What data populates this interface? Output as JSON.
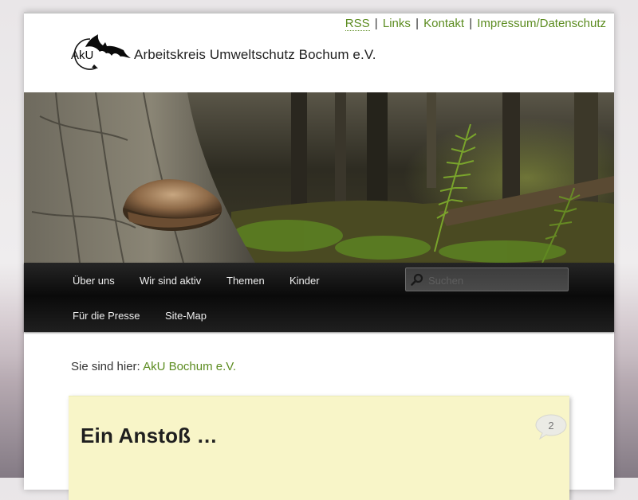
{
  "top_links": {
    "rss": "RSS",
    "separator": "|",
    "links": "Links",
    "kontakt": "Kontakt",
    "impressum": "Impressum/Datenschutz"
  },
  "logo": {
    "monogram": "AkU",
    "name": "Arbeitskreis Umweltschutz Bochum e.V."
  },
  "nav": {
    "items": [
      "Über uns",
      "Wir sind aktiv",
      "Themen",
      "Kinder",
      "Für die Presse",
      "Site-Map"
    ],
    "search_placeholder": "Suchen"
  },
  "breadcrumb": {
    "prefix": "Sie sind hier:",
    "link": "AkU Bochum e.V."
  },
  "post": {
    "title": "Ein Anstoß …",
    "comment_count": "2"
  },
  "colors": {
    "link_green": "#5c8c20",
    "nav_bg": "#111111",
    "post_bg": "#f8f5c8"
  }
}
